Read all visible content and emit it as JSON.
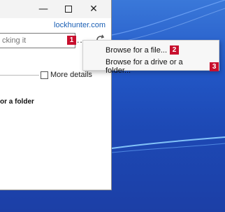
{
  "window": {
    "site_link": "lockhunter.com",
    "path_placeholder": "cking it",
    "ellipsis": "...",
    "more_details_label": "More details",
    "folder_text": "or a folder"
  },
  "markers": [
    "1",
    "2",
    "3"
  ],
  "menu": {
    "items": [
      {
        "label": "Browse for a file...",
        "marker": "2"
      },
      {
        "label": "Browse for a drive or a folder...",
        "marker": "3"
      }
    ]
  },
  "icons": {
    "minimize": "minimize-icon",
    "maximize": "maximize-icon",
    "close": "close-icon",
    "refresh": "refresh-icon"
  },
  "colors": {
    "marker": "#c8102e",
    "link": "#1a5fb4",
    "desktop": "#2256c5"
  }
}
